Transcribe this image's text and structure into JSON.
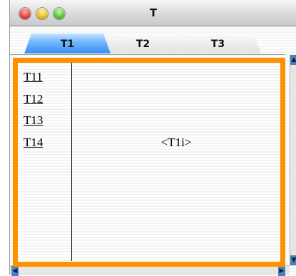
{
  "window": {
    "title": "T"
  },
  "tabs": [
    {
      "label": "T1",
      "active": true
    },
    {
      "label": "T2",
      "active": false
    },
    {
      "label": "T3",
      "active": false
    }
  ],
  "sidebar": {
    "items": [
      {
        "label": "T11"
      },
      {
        "label": "T12"
      },
      {
        "label": "T13"
      },
      {
        "label": "T14"
      }
    ]
  },
  "content": {
    "label": "<T1i>"
  },
  "colors": {
    "highlight": "#ff9000",
    "active_tab": "#6eb5ff",
    "close": "#e0443b",
    "minimize": "#e6bf24",
    "zoom": "#5cc13c"
  },
  "icons": {
    "scroll_up": "triangle-up-icon",
    "scroll_down": "triangle-down-icon",
    "scroll_left": "triangle-left-icon",
    "scroll_right": "triangle-right-icon"
  }
}
